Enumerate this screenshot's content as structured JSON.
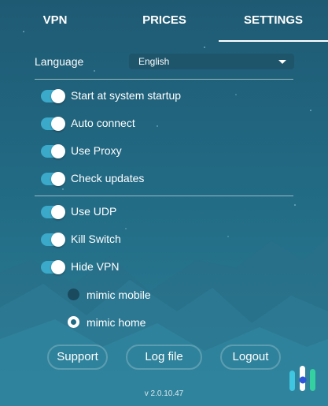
{
  "tabs": {
    "vpn": "VPN",
    "prices": "PRICES",
    "settings": "SETTINGS",
    "active": "SETTINGS"
  },
  "language": {
    "label": "Language",
    "selected": "English"
  },
  "toggles_general": [
    {
      "label": "Start at system startup",
      "on": true
    },
    {
      "label": "Auto connect",
      "on": true
    },
    {
      "label": "Use Proxy",
      "on": true
    },
    {
      "label": "Check updates",
      "on": true
    }
  ],
  "toggles_network": [
    {
      "label": "Use UDP",
      "on": true
    },
    {
      "label": "Kill Switch",
      "on": true
    },
    {
      "label": "Hide VPN",
      "on": true
    }
  ],
  "hide_vpn_modes": [
    {
      "label": "mimic mobile",
      "checked": false
    },
    {
      "label": "mimic home",
      "checked": true
    }
  ],
  "buttons": {
    "support": "Support",
    "log_file": "Log file",
    "logout": "Logout"
  },
  "version": "v 2.0.10.47",
  "colors": {
    "accent": "#3ba9c9",
    "background": "#226a84"
  },
  "icons": {
    "dropdown": "chevron-down-icon",
    "logo": "app-logo-icon"
  }
}
